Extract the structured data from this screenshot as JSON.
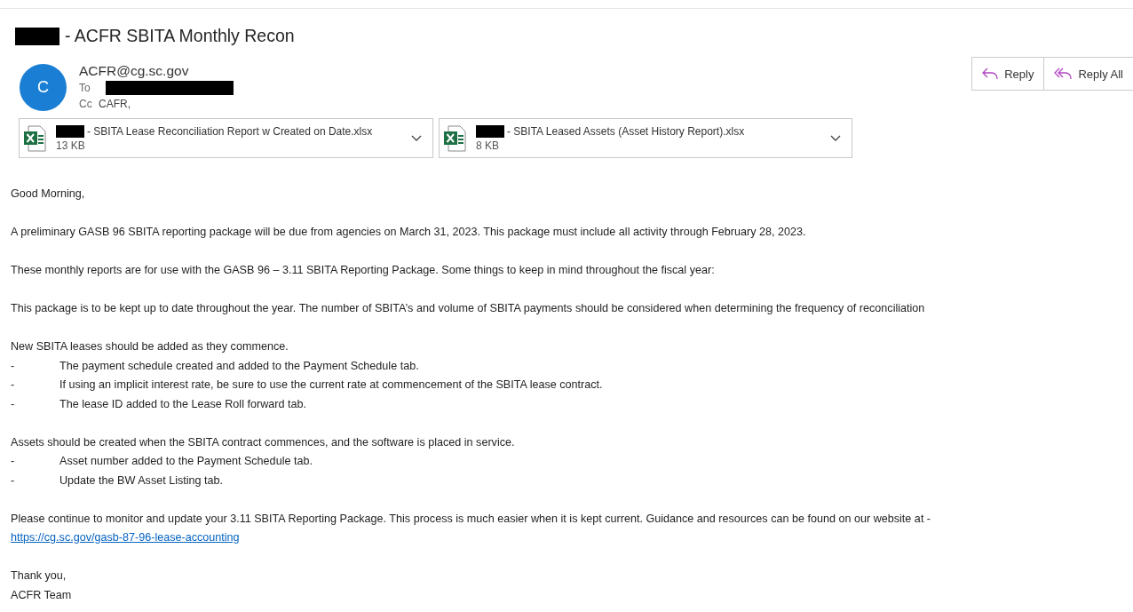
{
  "subject": {
    "redacted": true,
    "title": "- ACFR SBITA Monthly Recon"
  },
  "sender": {
    "avatar_letter": "C",
    "from": "ACFR@cg.sc.gov",
    "to_label": "To",
    "to_redacted": true,
    "cc_label": "Cc",
    "cc": "CAFR,"
  },
  "actions": [
    {
      "kind": "reply",
      "label": "Reply"
    },
    {
      "kind": "reply_all",
      "label": "Reply All"
    }
  ],
  "attachments": [
    {
      "redacted": true,
      "name": "- SBITA Lease Reconciliation Report w Created on Date.xlsx",
      "size": "13 KB"
    },
    {
      "redacted": true,
      "name": "- SBITA Leased Assets (Asset History Report).xlsx",
      "size": "8 KB"
    }
  ],
  "body": [
    {
      "kind": "paragraph",
      "text": "Good Morning,"
    },
    {
      "kind": "paragraph",
      "text": "A preliminary GASB 96 SBITA reporting package will be due from agencies on March 31, 2023.  This package must include all activity through February 28, 2023."
    },
    {
      "kind": "paragraph",
      "text": "These monthly reports are for use with the GASB 96 – 3.11 SBITA Reporting Package.  Some things to keep in mind throughout the fiscal year:"
    },
    {
      "kind": "paragraph",
      "text": "This package is to be kept up to date throughout the year.  The number of SBITA’s and volume of SBITA payments should be considered when determining the frequency of reconciliation"
    },
    {
      "kind": "list",
      "intro": "New SBITA leases should be added as they commence.",
      "items": [
        {
          "marker": "-",
          "text": "The payment schedule created and added to the Payment Schedule tab."
        },
        {
          "marker": "-",
          "text": "If using an implicit interest rate, be sure to use the current rate at commencement of the SBITA lease contract."
        },
        {
          "marker": "-",
          "text": "The lease ID added to the Lease Roll forward tab."
        }
      ]
    },
    {
      "kind": "list",
      "intro": "Assets should be created when the SBITA contract commences, and the software is placed in service.",
      "items": [
        {
          "marker": "-",
          "text": "Asset number added to the Payment Schedule tab."
        },
        {
          "marker": "-",
          "text": "Update the BW Asset Listing tab."
        }
      ]
    },
    {
      "kind": "link_paragraph",
      "text": "Please continue to monitor and update your 3.11 SBITA Reporting Package. This process is much easier when it is kept current. Guidance and resources can be found on our website at -",
      "link": "https://cg.sc.gov/gasb-87-96-lease-accounting"
    },
    {
      "kind": "signature",
      "lines": [
        "Thank you,",
        "ACFR Team"
      ]
    }
  ]
}
